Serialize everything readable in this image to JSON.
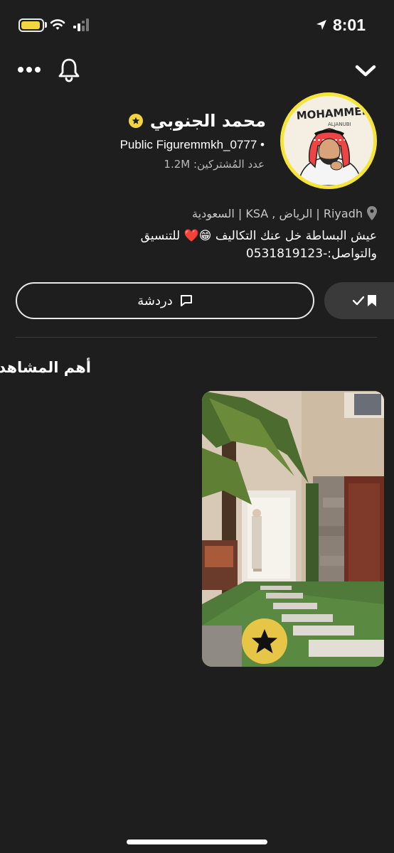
{
  "status_bar": {
    "time": "8:01"
  },
  "top_actions": {
    "more_icon": "more-horizontal-icon",
    "bell_icon": "bell-icon",
    "chevron_icon": "chevron-down-icon"
  },
  "profile": {
    "name": "محمد الجنوبي",
    "subtitle": "Public Figuremmkh_0777 •",
    "subscribers": "عدد المُشتركين: 1.2M",
    "location": "Riyadh | الرياض , KSA | السعودية",
    "bio": "عيش البساطة خل عنك التكاليف 😁❤️ للتنسيق والتواصل:-0531819123",
    "avatar_text": "MOHAMMED",
    "avatar_subtext": "ALJANUBI"
  },
  "buttons": {
    "chat_label": "دردشة"
  },
  "highlights": {
    "title": "أهم المشاهد"
  },
  "colors": {
    "background": "#1e1e1e",
    "accent_yellow": "#f3d63f"
  }
}
